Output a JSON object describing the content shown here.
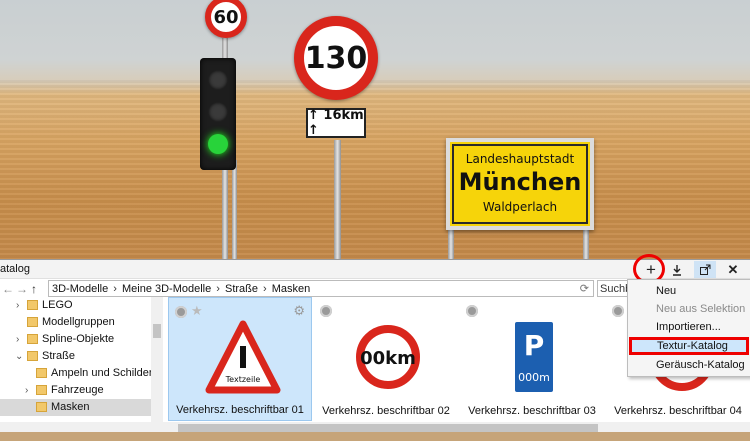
{
  "scene": {
    "speed_sign_small": "60",
    "speed_sign_large": "130",
    "distance_plate": "↑ 16km ↑",
    "town_sign": {
      "line1": "Landeshauptstadt",
      "line2": "München",
      "line3": "Waldperlach"
    }
  },
  "panel": {
    "title": "atalog",
    "toolbar": {
      "add_icon": "plus-icon",
      "download_icon": "download-icon",
      "popout_icon": "popout-icon",
      "close_icon": "close-icon"
    },
    "nav": {
      "back_icon": "arrow-left-icon",
      "forward_icon": "arrow-right-icon",
      "up_icon": "arrow-up-icon",
      "breadcrumb": [
        "3D-Modelle",
        "Meine 3D-Modelle",
        "Straße",
        "Masken"
      ],
      "search_placeholder": "Suchbe"
    },
    "tree": [
      {
        "label": "LEGO",
        "chevron": "›",
        "indent": 0,
        "selected": false
      },
      {
        "label": "Modellgruppen",
        "chevron": "",
        "indent": 0,
        "selected": false
      },
      {
        "label": "Spline-Objekte",
        "chevron": "›",
        "indent": 0,
        "selected": false
      },
      {
        "label": "Straße",
        "chevron": "⌄",
        "indent": 0,
        "selected": false
      },
      {
        "label": "Ampeln und Schilder",
        "chevron": "",
        "indent": 1,
        "selected": false
      },
      {
        "label": "Fahrzeuge",
        "chevron": "›",
        "indent": 1,
        "selected": false
      },
      {
        "label": "Masken",
        "chevron": "",
        "indent": 1,
        "selected": true
      }
    ],
    "tiles": [
      {
        "name": "Verkehrsz. beschriftbar 01",
        "selected": true,
        "sign": "Textzeile"
      },
      {
        "name": "Verkehrsz. beschriftbar 02",
        "selected": false,
        "sign": "00km"
      },
      {
        "name": "Verkehrsz. beschriftbar 03",
        "selected": false,
        "sign_top": "P",
        "sign_bottom": "000m"
      },
      {
        "name": "Verkehrsz. beschriftbar 04",
        "selected": false
      }
    ]
  },
  "menu": {
    "items": [
      {
        "label": "Neu",
        "disabled": false,
        "highlighted": false
      },
      {
        "label": "Neu aus Selektion",
        "disabled": true,
        "highlighted": false
      },
      {
        "label": "Importieren...",
        "disabled": false,
        "highlighted": false
      },
      {
        "label": "Textur-Katalog",
        "disabled": false,
        "highlighted": true
      },
      {
        "label": "Geräusch-Katalog",
        "disabled": false,
        "highlighted": false
      }
    ]
  },
  "colors": {
    "selection": "#cde6fb",
    "highlight_red": "#ee0000",
    "town_sign_yellow": "#f6d40a"
  }
}
